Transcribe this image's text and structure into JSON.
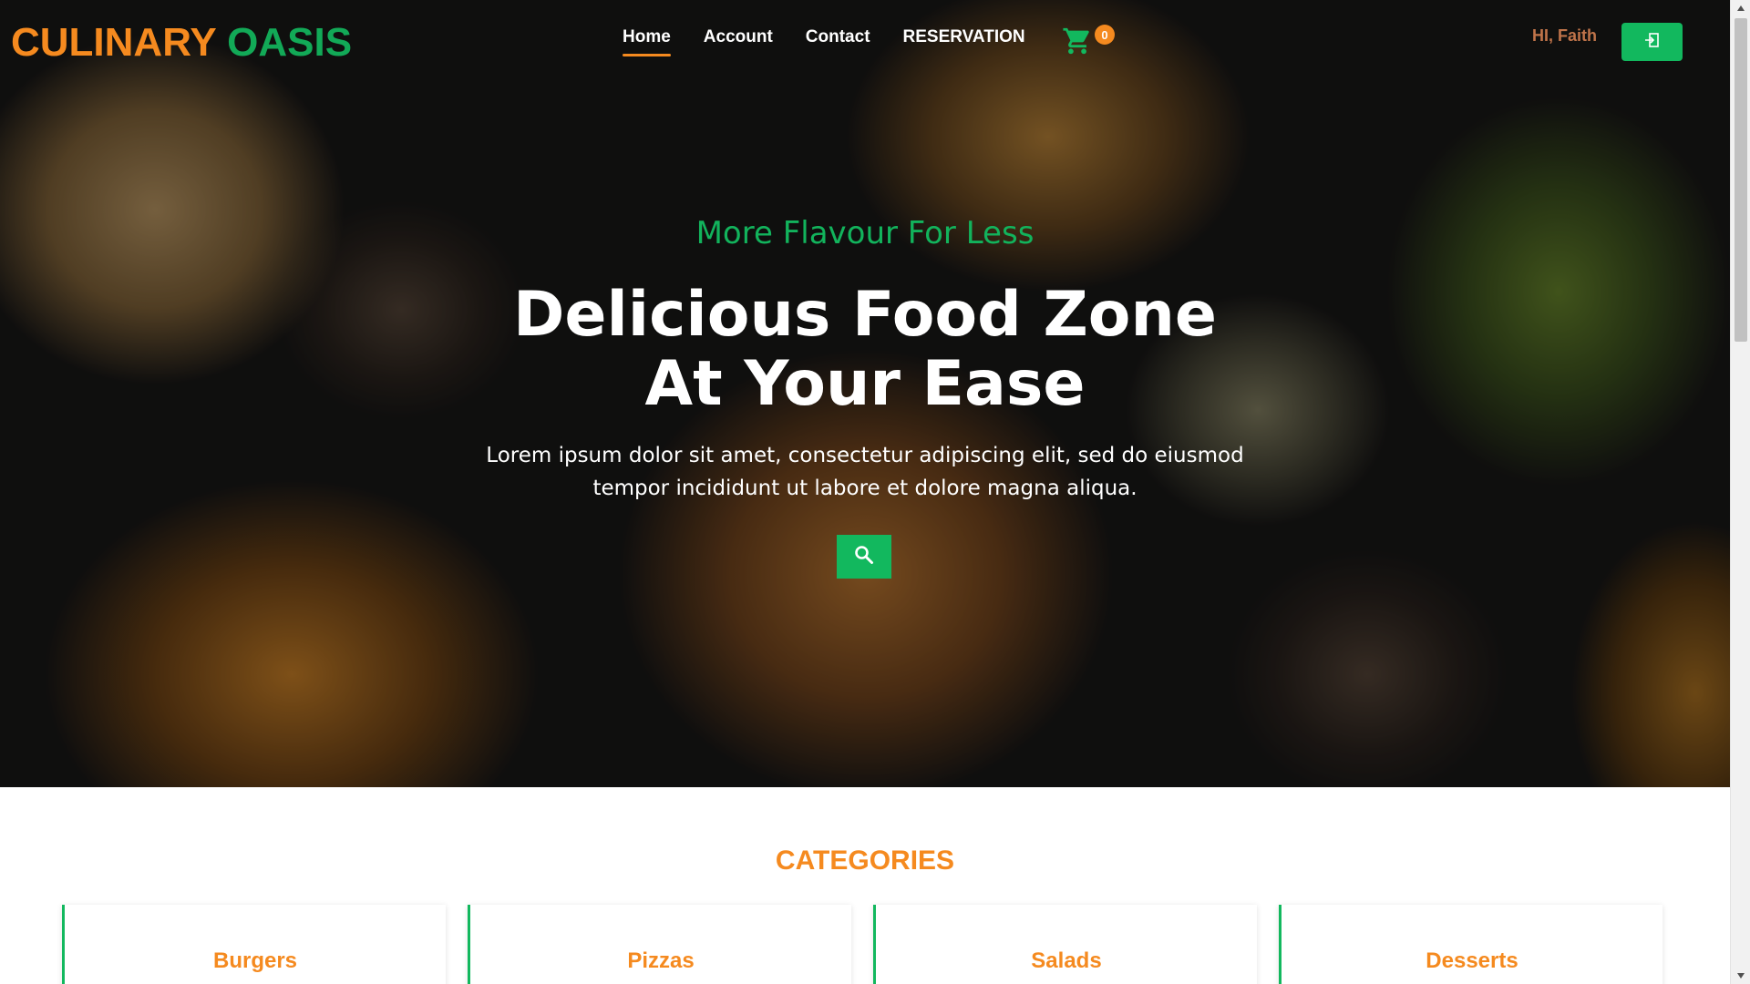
{
  "brand": {
    "word1": "CULINARY",
    "word2": "OASIS"
  },
  "nav": {
    "links": [
      {
        "label": "Home",
        "active": true
      },
      {
        "label": "Account",
        "active": false
      },
      {
        "label": "Contact",
        "active": false
      },
      {
        "label": "RESERVATION",
        "active": false
      }
    ],
    "cart_count": "0",
    "cart_icon": "cart-icon",
    "greeting": "HI, Faith",
    "logout_icon": "logout-icon"
  },
  "hero": {
    "tagline": "More Flavour For Less",
    "headline_line1": "Delicious Food Zone",
    "headline_line2": "At Your Ease",
    "lead": "Lorem ipsum dolor sit amet, consectetur adipiscing elit, sed do eiusmod tempor incididunt ut labore et dolore magna aliqua.",
    "search_icon": "search-icon"
  },
  "categories": {
    "title": "CATEGORIES",
    "items": [
      "Burgers",
      "Pizzas",
      "Salads",
      "Desserts"
    ]
  },
  "colors": {
    "brand_orange": "#f58a1f",
    "brand_green": "#12b85e",
    "greeting": "#c0744a"
  }
}
